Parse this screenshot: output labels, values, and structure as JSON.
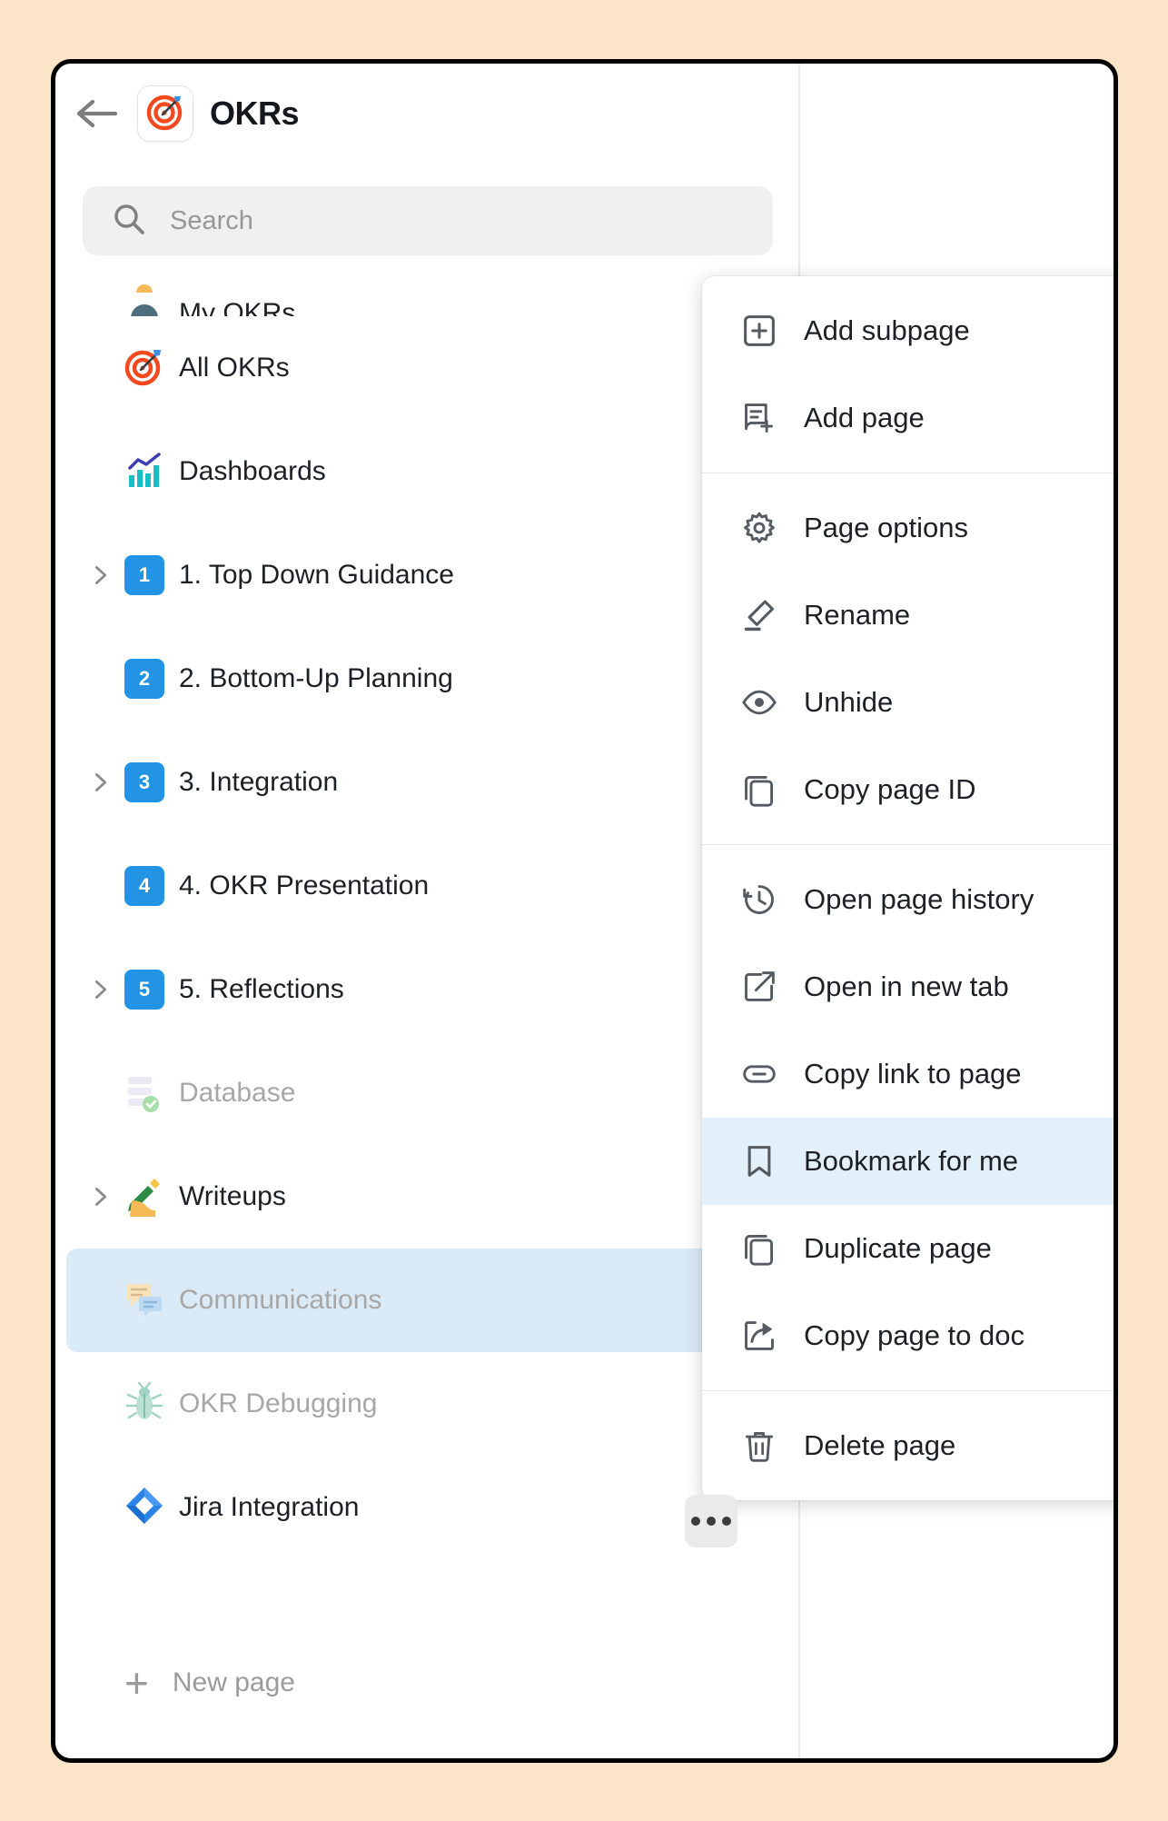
{
  "header": {
    "back_icon": "arrow-left-icon",
    "app_icon": "target-dartboard-icon",
    "title": "OKRs"
  },
  "search": {
    "icon": "search-icon",
    "placeholder": "Search",
    "value": ""
  },
  "sidebar": {
    "items": [
      {
        "label": "My OKRs",
        "icon": "bust-in-silhouette-emoji",
        "expandable": false,
        "muted": false,
        "selected": false,
        "clipped": true
      },
      {
        "label": "All OKRs",
        "icon": "target-dartboard-emoji",
        "expandable": false,
        "muted": false,
        "selected": false,
        "clipped": false
      },
      {
        "label": "Dashboards",
        "icon": "bar-chart-emoji",
        "expandable": false,
        "muted": false,
        "selected": false,
        "clipped": false
      },
      {
        "label": "1. Top Down Guidance",
        "icon": "number-chip-1",
        "expandable": true,
        "muted": false,
        "selected": false,
        "clipped": false
      },
      {
        "label": "2. Bottom-Up Planning",
        "icon": "number-chip-2",
        "expandable": false,
        "muted": false,
        "selected": false,
        "clipped": false
      },
      {
        "label": "3. Integration",
        "icon": "number-chip-3",
        "expandable": true,
        "muted": false,
        "selected": false,
        "clipped": false
      },
      {
        "label": "4. OKR Presentation",
        "icon": "number-chip-4",
        "expandable": false,
        "muted": false,
        "selected": false,
        "clipped": false
      },
      {
        "label": "5. Reflections",
        "icon": "number-chip-5",
        "expandable": true,
        "muted": false,
        "selected": false,
        "clipped": false
      },
      {
        "label": "Database",
        "icon": "database-check-emoji",
        "expandable": false,
        "muted": true,
        "selected": false,
        "clipped": false
      },
      {
        "label": "Writeups",
        "icon": "writing-hand-emoji",
        "expandable": true,
        "muted": false,
        "selected": false,
        "clipped": false
      },
      {
        "label": "Communications",
        "icon": "speech-balloons-emoji",
        "expandable": false,
        "muted": true,
        "selected": true,
        "clipped": false
      },
      {
        "label": "OKR Debugging",
        "icon": "bug-emoji",
        "expandable": false,
        "muted": true,
        "selected": false,
        "clipped": false
      },
      {
        "label": "Jira Integration",
        "icon": "jira-diamond-icon",
        "expandable": false,
        "muted": false,
        "selected": false,
        "clipped": false
      }
    ],
    "new_page": {
      "label": "New page",
      "icon": "plus-icon"
    },
    "row_menu_button": {
      "icon": "more-horizontal-icon",
      "label": "•••"
    }
  },
  "context_menu": {
    "groups": [
      {
        "items": [
          {
            "label": "Add subpage",
            "icon": "square-plus-icon",
            "submenu": true,
            "active": false
          },
          {
            "label": "Add page",
            "icon": "page-plus-icon",
            "submenu": true,
            "active": false
          }
        ]
      },
      {
        "items": [
          {
            "label": "Page options",
            "icon": "gear-icon",
            "submenu": false,
            "active": false
          },
          {
            "label": "Rename",
            "icon": "pencil-icon",
            "submenu": false,
            "active": false
          },
          {
            "label": "Unhide",
            "icon": "eye-icon",
            "submenu": false,
            "active": false
          },
          {
            "label": "Copy page ID",
            "icon": "copy-icon",
            "submenu": false,
            "active": false
          }
        ]
      },
      {
        "items": [
          {
            "label": "Open page history",
            "icon": "history-clock-icon",
            "submenu": false,
            "active": false
          },
          {
            "label": "Open in new tab",
            "icon": "external-link-icon",
            "submenu": false,
            "active": false
          },
          {
            "label": "Copy link to page",
            "icon": "chain-link-icon",
            "submenu": false,
            "active": false
          },
          {
            "label": "Bookmark for me",
            "icon": "bookmark-icon",
            "submenu": false,
            "active": true
          },
          {
            "label": "Duplicate page",
            "icon": "copy-icon",
            "submenu": false,
            "active": false
          },
          {
            "label": "Copy page to doc",
            "icon": "share-arrow-icon",
            "submenu": false,
            "active": false
          }
        ]
      },
      {
        "items": [
          {
            "label": "Delete page",
            "icon": "trash-icon",
            "submenu": false,
            "active": false
          }
        ]
      }
    ]
  },
  "colors": {
    "page_background": "#fbe4c7",
    "window_border": "#000000",
    "accent_blue": "#2294e3",
    "selected_row": "#dbeaf7",
    "menu_active": "#e4f0f9",
    "search_background": "#f0f0f0",
    "muted_text": "#a7a7a7"
  }
}
